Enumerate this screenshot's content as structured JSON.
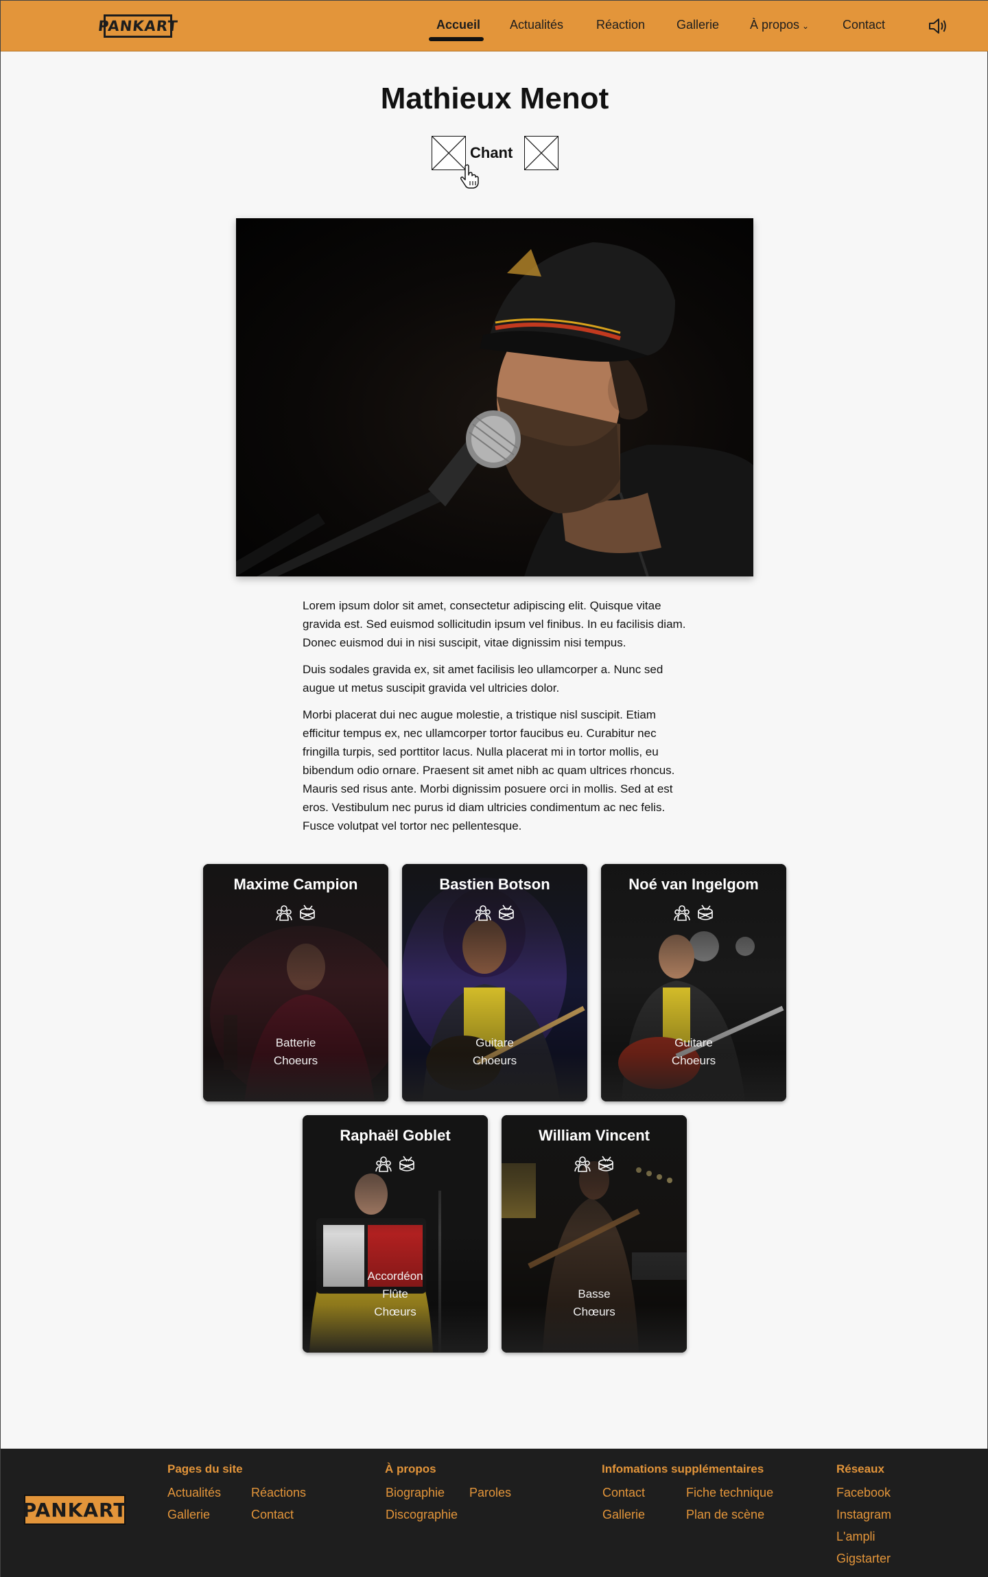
{
  "brand": {
    "logo_text": "PANKART"
  },
  "nav": {
    "items": [
      "Accueil",
      "Actualités",
      "Réaction",
      "Gallerie",
      "À propos",
      "Contact"
    ],
    "active": "Accueil",
    "sound_icon": "speaker-icon"
  },
  "page": {
    "title": "Mathieux Menot",
    "role": "Chant"
  },
  "bio": {
    "paragraphs": [
      "Lorem ipsum dolor sit amet, consectetur adipiscing elit. Quisque vitae gravida est. Sed euismod sollicitudin ipsum vel finibus. In eu facilisis diam. Donec euismod dui in nisi suscipit, vitae dignissim nisi tempus.",
      "Duis sodales gravida ex, sit amet facilisis leo ullamcorper a. Nunc sed augue ut metus suscipit gravida vel ultricies dolor.",
      "Morbi placerat dui nec augue molestie, a tristique nisl suscipit. Etiam efficitur tempus ex, nec ullamcorper tortor faucibus eu. Curabitur nec fringilla turpis, sed porttitor lacus. Nulla placerat mi in tortor mollis, eu bibendum odio ornare. Praesent sit amet nibh ac quam ultrices rhoncus. Mauris sed risus ante. Morbi dignissim posuere orci in mollis. Sed at est eros. Vestibulum nec purus id diam ultricies condimentum ac nec felis. Fusce volutpat vel tortor nec pellentesque."
    ]
  },
  "members": [
    {
      "name": "Maxime Campion",
      "roles": [
        "Batterie",
        "Choeurs"
      ]
    },
    {
      "name": "Bastien Botson",
      "roles": [
        "Guitare",
        "Choeurs"
      ]
    },
    {
      "name": "Noé van Ingelgom",
      "roles": [
        "Guitare",
        "Choeurs"
      ]
    },
    {
      "name": "Raphaël Goblet",
      "roles": [
        "Accordéon",
        "Flûte",
        "Chœurs"
      ]
    },
    {
      "name": "William Vincent",
      "roles": [
        "Basse",
        "Chœurs"
      ]
    }
  ],
  "footer": {
    "logo_text": "PANKART",
    "pages": {
      "heading": "Pages du site",
      "links": [
        "Actualités",
        "Réactions",
        "Gallerie",
        "Contact"
      ]
    },
    "about": {
      "heading": "À propos",
      "links": [
        "Biographie",
        "Paroles",
        "Discographie"
      ]
    },
    "info": {
      "heading": "Infomations supplémentaires",
      "links": [
        "Contact",
        "Fiche technique",
        "Gallerie",
        "Plan de scène"
      ]
    },
    "social": {
      "heading": "Réseaux",
      "links": [
        "Facebook",
        "Instagram",
        "L'ampli",
        "Gigstarter"
      ]
    }
  },
  "colors": {
    "accent": "#e3953a",
    "footer_bg": "#1e1e1e",
    "page_bg": "#f7f7f7"
  }
}
